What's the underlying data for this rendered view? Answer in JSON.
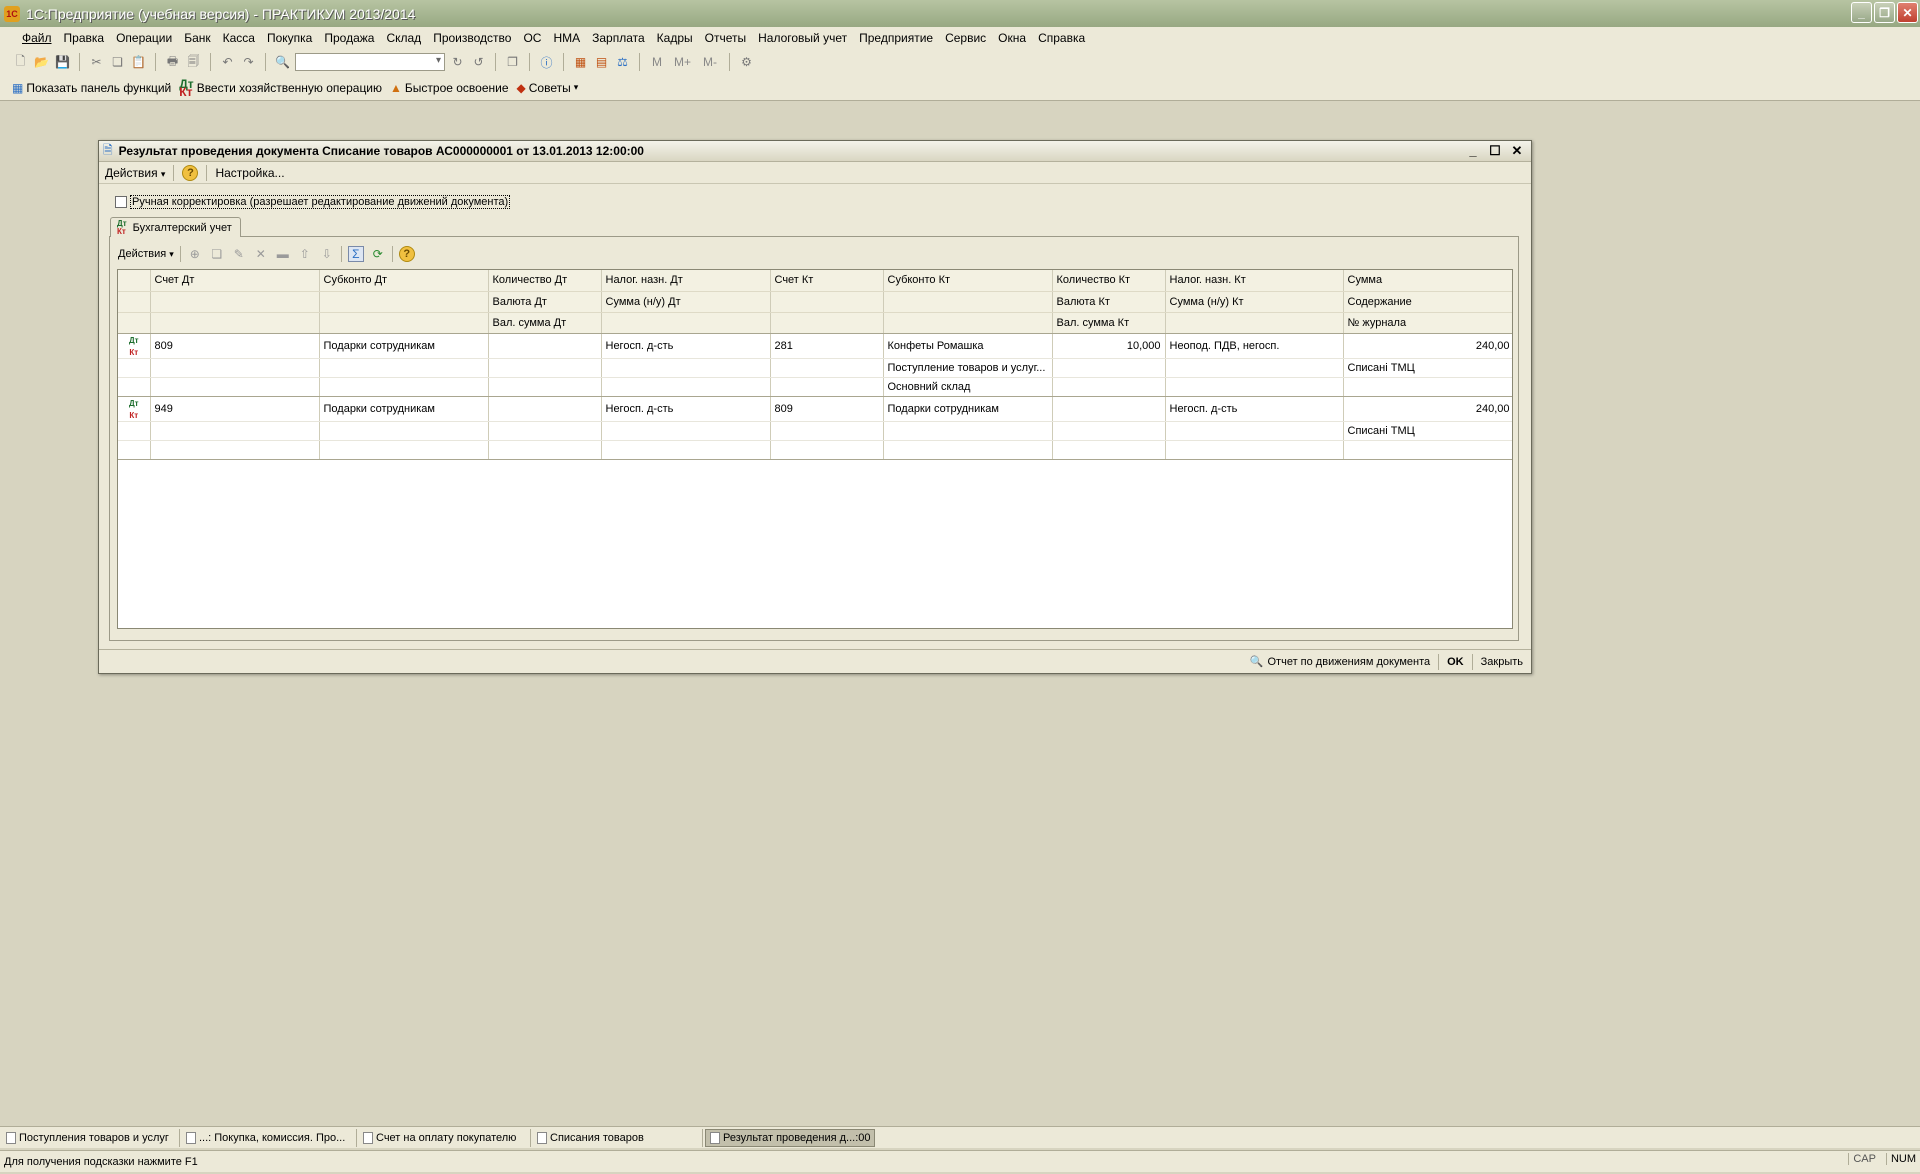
{
  "app": {
    "title": "1С:Предприятие (учебная версия) - ПРАКТИКУМ 2013/2014",
    "icon_label": "1С"
  },
  "menu": [
    "Файл",
    "Правка",
    "Операции",
    "Банк",
    "Касса",
    "Покупка",
    "Продажа",
    "Склад",
    "Производство",
    "ОС",
    "НМА",
    "Зарплата",
    "Кадры",
    "Отчеты",
    "Налоговый учет",
    "Предприятие",
    "Сервис",
    "Окна",
    "Справка"
  ],
  "toolbar2": {
    "show_panel": "Показать панель функций",
    "enter_operation": "Ввести хозяйственную операцию",
    "quick_learning": "Быстрое освоение",
    "tips": "Советы"
  },
  "doc": {
    "title": "Результат проведения документа Списание товаров АС000000001 от 13.01.2013 12:00:00",
    "actions": "Действия",
    "settings": "Настройка...",
    "manual_label": "Ручная корректировка (разрешает редактирование движений документа)",
    "tab_label": "Бухгалтерский учет",
    "grid_actions": "Действия",
    "foot_report": "Отчет по движениям документа",
    "foot_ok": "OK",
    "foot_close": "Закрыть"
  },
  "table": {
    "header_rows": [
      [
        "Счет Дт",
        "Субконто Дт",
        "Количество Дт",
        "Налог. назн. Дт",
        "Счет Кт",
        "Субконто Кт",
        "Количество Кт",
        "Налог. назн. Кт",
        "Сумма"
      ],
      [
        "",
        "",
        "Валюта Дт",
        "Сумма (н/у) Дт",
        "",
        "",
        "Валюта Кт",
        "Сумма (н/у) Кт",
        "Содержание"
      ],
      [
        "",
        "",
        "Вал. сумма Дт",
        "",
        "",
        "",
        "Вал. сумма Кт",
        "",
        "№ журнала"
      ]
    ],
    "rows": [
      [
        [
          "809",
          "Подарки сотрудникам",
          "",
          "Негосп. д-сть",
          "281",
          "Конфеты Ромашка",
          "10,000",
          "Неопод. ПДВ, негосп.",
          "240,00"
        ],
        [
          "",
          "",
          "",
          "",
          "",
          "Поступление товаров и услуг...",
          "",
          "",
          "Списані ТМЦ"
        ],
        [
          "",
          "",
          "",
          "",
          "",
          "Основний склад",
          "",
          "",
          ""
        ]
      ],
      [
        [
          "949",
          "Подарки сотрудникам",
          "",
          "Негосп. д-сть",
          "809",
          "Подарки сотрудникам",
          "",
          "Негосп. д-сть",
          "240,00"
        ],
        [
          "",
          "",
          "",
          "",
          "",
          "",
          "",
          "",
          "Списані ТМЦ"
        ],
        [
          "",
          "",
          "",
          "",
          "",
          "",
          "",
          "",
          ""
        ]
      ]
    ]
  },
  "taskbar": [
    "Поступления товаров и услуг",
    "...: Покупка, комиссия. Про...",
    "Счет на оплату покупателю",
    "Списания товаров",
    "Результат проведения д...:00"
  ],
  "status": {
    "hint": "Для получения подсказки нажмите F1",
    "cap": "CAP",
    "num": "NUM"
  }
}
